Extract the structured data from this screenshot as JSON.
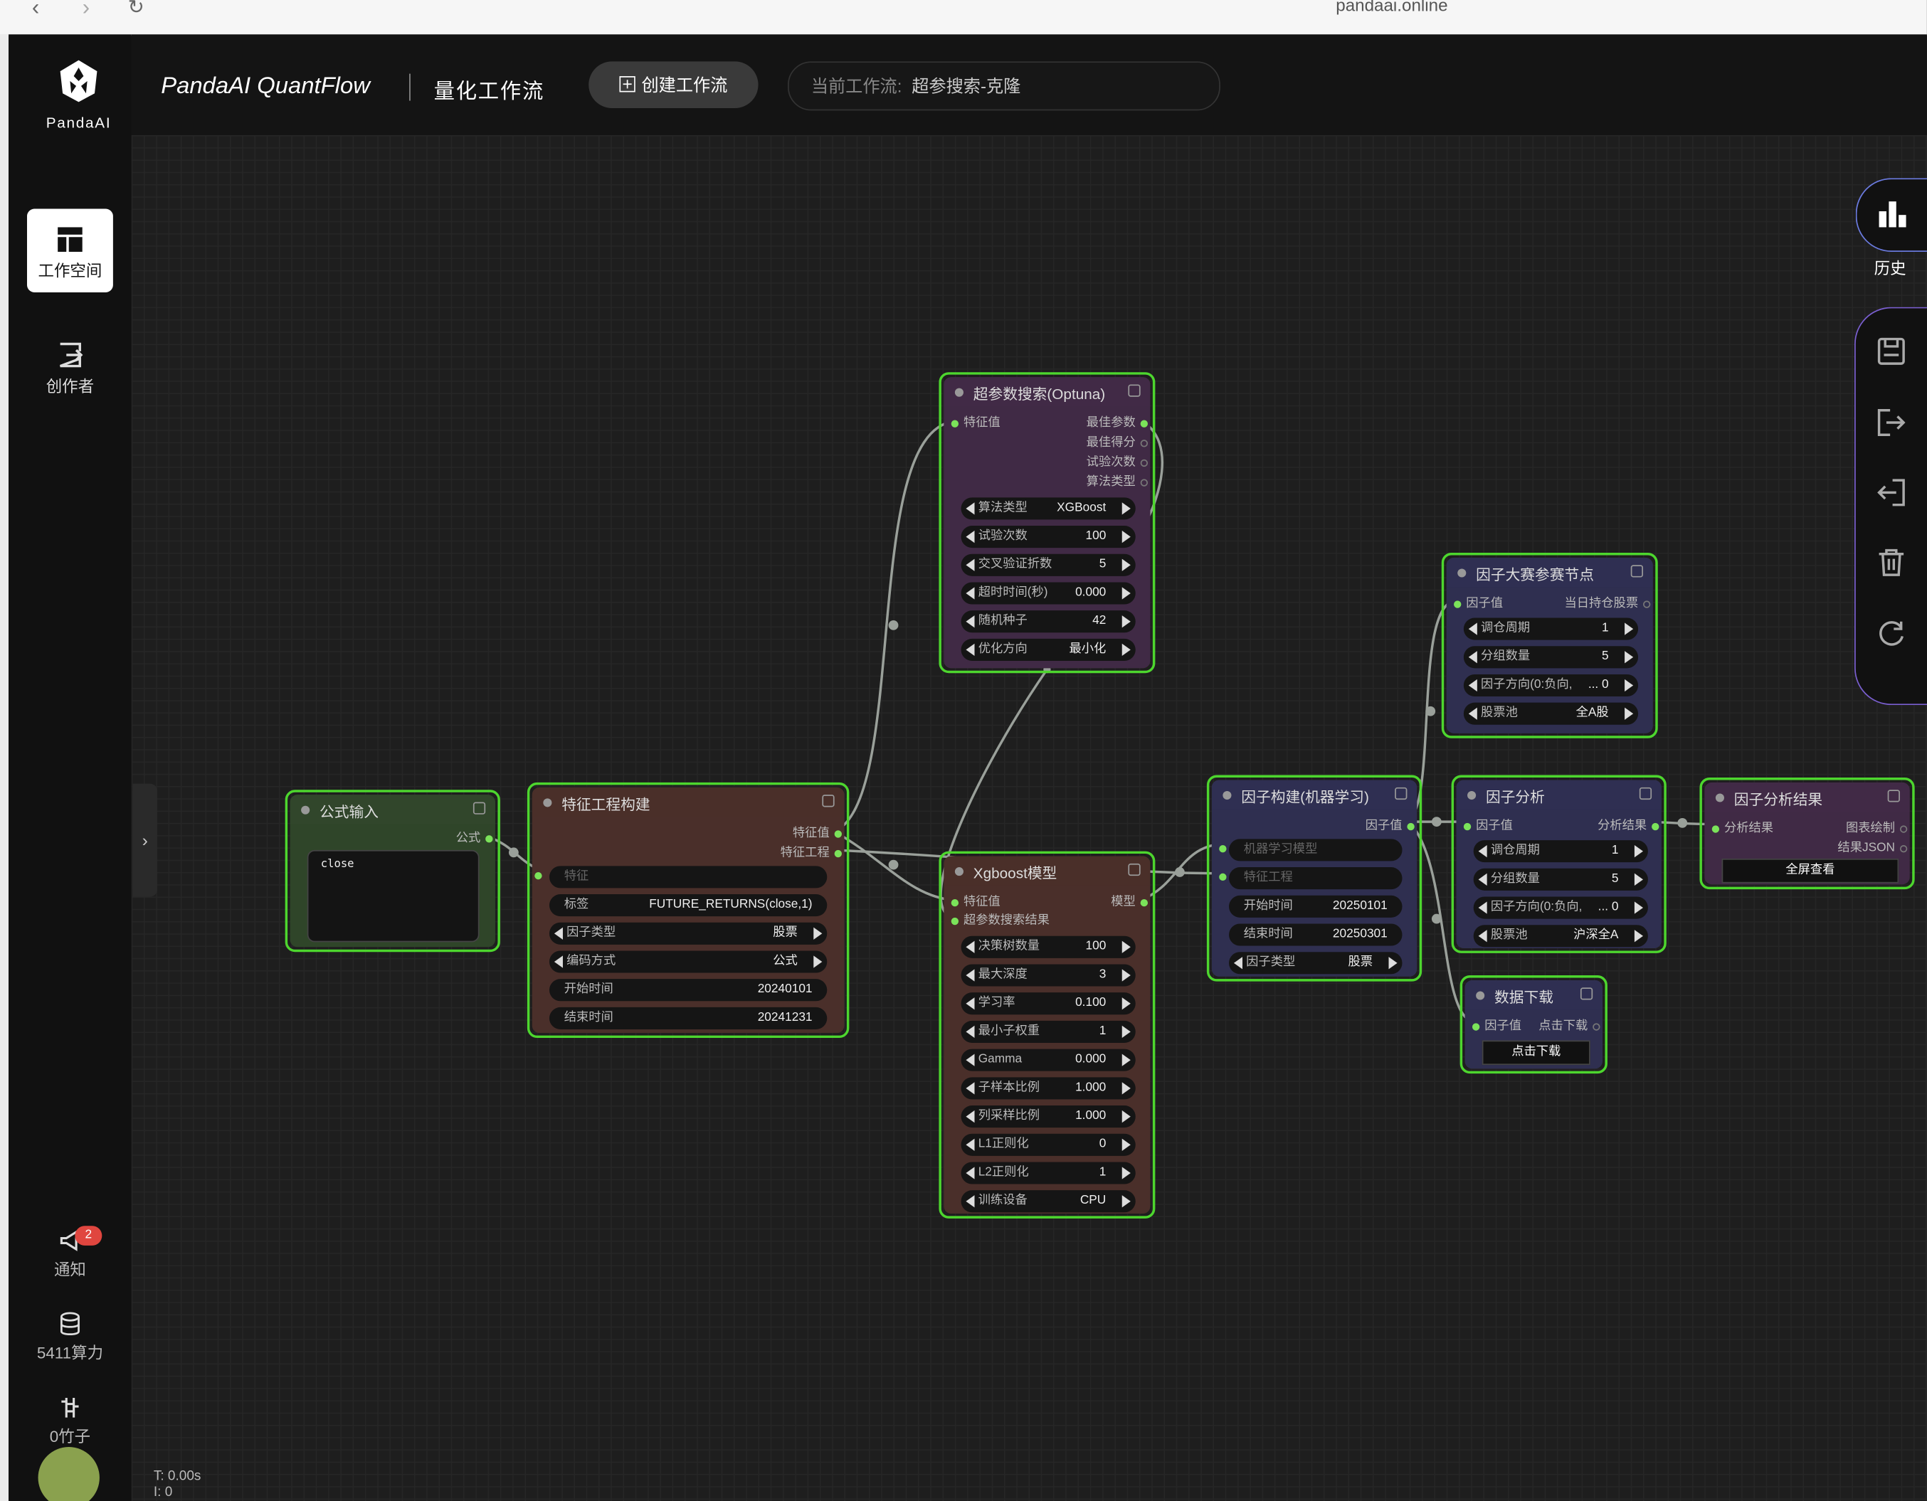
{
  "browser": {
    "back": "‹",
    "forward": "›",
    "reload": "↻",
    "url": "pandaai.online"
  },
  "sidebar": {
    "logo_text": "PandaAI",
    "items": [
      {
        "label": "工作空间",
        "icon": "workspace-icon",
        "active": true
      },
      {
        "label": "创作者",
        "icon": "creator-icon",
        "active": false
      }
    ],
    "notify": {
      "label": "通知",
      "badge": "2"
    },
    "compute": {
      "label": "5411算力"
    },
    "bamboo": {
      "label": "0竹子"
    }
  },
  "header": {
    "app_title": "PandaAI QuantFlow",
    "sub_title": "量化工作流",
    "create_button": "创建工作流",
    "current_flow_label": "当前工作流:",
    "current_flow_value": "超参搜索-克隆"
  },
  "right_toolbar": {
    "history_label": "历史",
    "tools": [
      "save-icon",
      "export-icon",
      "import-icon",
      "delete-icon",
      "refresh-icon"
    ]
  },
  "status": {
    "time": "T: 0.00s",
    "count": "I: 0"
  },
  "colors": {
    "accent": "#4dd62e",
    "port": "#7be35a",
    "node_border": "#4dd62e"
  },
  "nodes": {
    "formula": {
      "title": "公式输入",
      "out_formula": "公式",
      "code": "close"
    },
    "feature": {
      "title": "特征工程构建",
      "out_value": "特征值",
      "out_engineering": "特征工程",
      "feature_placeholder": "特征",
      "label_name": "标签",
      "label_value": "FUTURE_RETURNS(close,1)",
      "factor_type_name": "因子类型",
      "factor_type_value": "股票",
      "encoding_name": "编码方式",
      "encoding_value": "公式",
      "start_name": "开始时间",
      "start_value": "20240101",
      "end_name": "结束时间",
      "end_value": "20241231"
    },
    "optuna": {
      "title": "超参数搜索(Optuna)",
      "in_value": "特征值",
      "out_best_params": "最佳参数",
      "out_best_score": "最佳得分",
      "out_trials": "试验次数",
      "out_algo": "算法类型",
      "widgets": [
        {
          "name": "算法类型",
          "value": "XGBoost"
        },
        {
          "name": "试验次数",
          "value": "100"
        },
        {
          "name": "交叉验证折数",
          "value": "5"
        },
        {
          "name": "超时时间(秒)",
          "value": "0.000"
        },
        {
          "name": "随机种子",
          "value": "42"
        },
        {
          "name": "优化方向",
          "value": "最小化"
        }
      ]
    },
    "xgboost": {
      "title": "Xgboost模型",
      "in_value": "特征值",
      "in_search": "超参数搜索结果",
      "out_model": "模型",
      "widgets": [
        {
          "name": "决策树数量",
          "value": "100"
        },
        {
          "name": "最大深度",
          "value": "3"
        },
        {
          "name": "学习率",
          "value": "0.100"
        },
        {
          "name": "最小子权重",
          "value": "1"
        },
        {
          "name": "Gamma",
          "value": "0.000"
        },
        {
          "name": "子样本比例",
          "value": "1.000"
        },
        {
          "name": "列采样比例",
          "value": "1.000"
        },
        {
          "name": "L1正则化",
          "value": "0"
        },
        {
          "name": "L2正则化",
          "value": "1"
        },
        {
          "name": "训练设备",
          "value": "CPU"
        }
      ]
    },
    "factor_ml": {
      "title": "因子构建(机器学习)",
      "out_value": "因子值",
      "in_model": "机器学习模型",
      "in_engineering": "特征工程",
      "start_name": "开始时间",
      "start_value": "20250101",
      "end_name": "结束时间",
      "end_value": "20250301",
      "type_name": "因子类型",
      "type_value": "股票"
    },
    "contest": {
      "title": "因子大赛参赛节点",
      "in_value": "因子值",
      "out_holdings": "当日持仓股票",
      "widgets": [
        {
          "name": "调仓周期",
          "value": "1"
        },
        {
          "name": "分组数量",
          "value": "5"
        },
        {
          "name": "因子方向(0:负向,",
          "value": "... 0"
        },
        {
          "name": "股票池",
          "value": "全A股"
        }
      ]
    },
    "analysis": {
      "title": "因子分析",
      "in_value": "因子值",
      "out_result": "分析结果",
      "widgets": [
        {
          "name": "调仓周期",
          "value": "1"
        },
        {
          "name": "分组数量",
          "value": "5"
        },
        {
          "name": "因子方向(0:负向,",
          "value": "... 0"
        },
        {
          "name": "股票池",
          "value": "沪深全A"
        }
      ]
    },
    "analysis_result": {
      "title": "因子分析结果",
      "in_result": "分析结果",
      "out_chart": "图表绘制",
      "out_json": "结果JSON",
      "button": "全屏查看"
    },
    "download": {
      "title": "数据下载",
      "in_value": "因子值",
      "out_download": "点击下载",
      "button": "点击下载"
    }
  }
}
